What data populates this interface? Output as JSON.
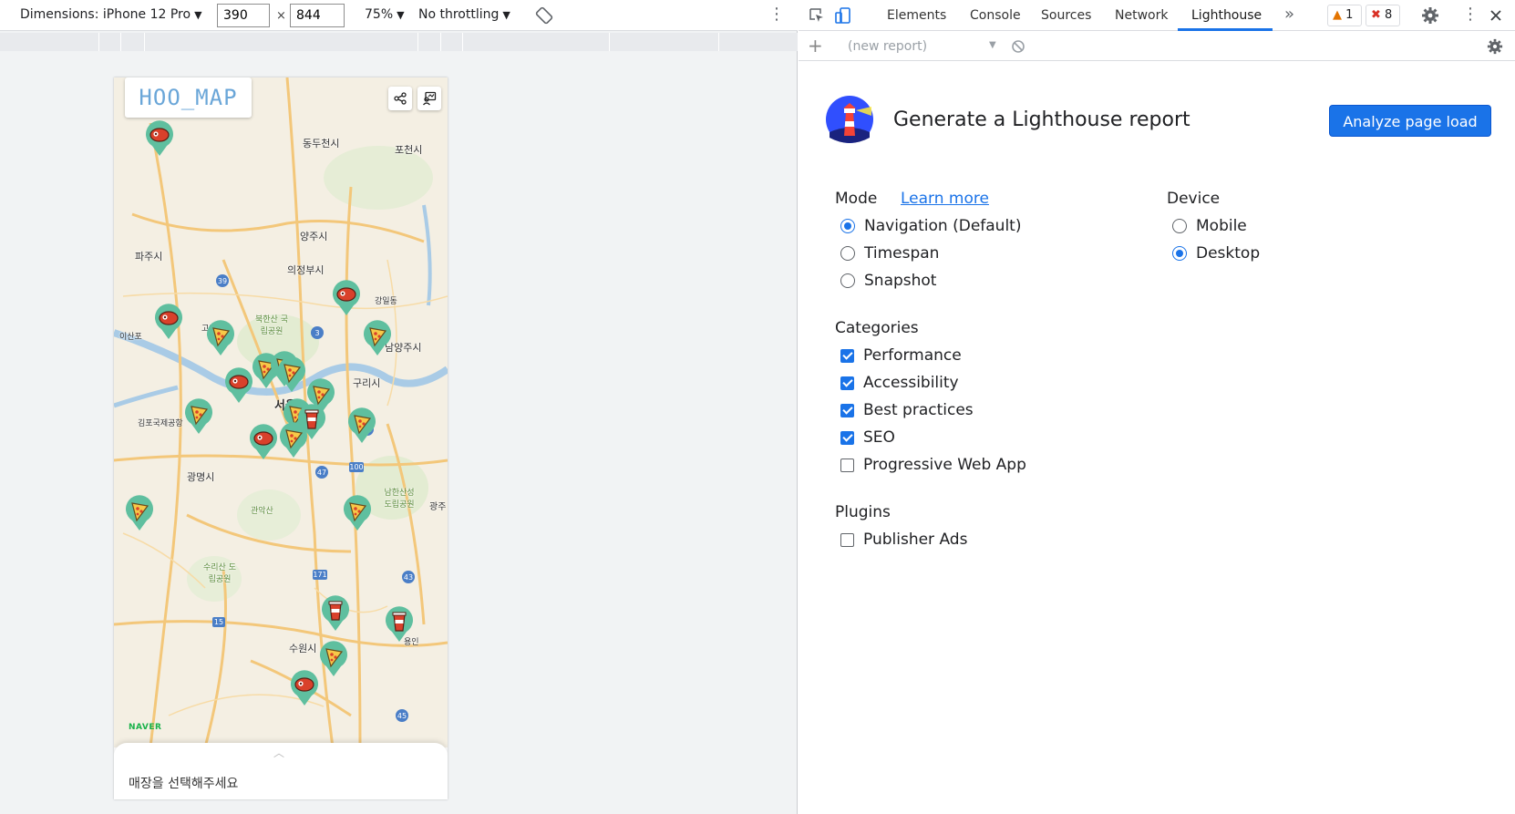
{
  "device_toolbar": {
    "dimensions_label": "Dimensions: iPhone 12 Pro",
    "width_value": "390",
    "times": "×",
    "height_value": "844",
    "zoom": "75%",
    "throttling": "No throttling",
    "caret": "▼",
    "more": "⋮"
  },
  "app": {
    "logo_text": "HOO_MAP",
    "sheet_message": "매장을 선택해주세요",
    "naver_label": "NAVER",
    "handle": "︿",
    "places": [
      "동두천시",
      "포천시",
      "양주시",
      "파주시",
      "의정부시",
      "남양주시",
      "구리시",
      "서울",
      "광명시",
      "수원시",
      "북한산 국립공원",
      "관악산",
      "남한산성 도립공원",
      "수리산 도립공원",
      "이산포",
      "김포국제공항",
      "고양",
      "강일동",
      "광주",
      "용인"
    ]
  },
  "devtools": {
    "tabs": [
      "Elements",
      "Console",
      "Sources",
      "Network",
      "Lighthouse"
    ],
    "active_tab": "Lighthouse",
    "more_tabs": "»",
    "warning_count": "1",
    "error_count": "8",
    "report_placeholder": "(new report)",
    "add_button": "+"
  },
  "lighthouse": {
    "title": "Generate a Lighthouse report",
    "analyze_button": "Analyze page load",
    "mode_label": "Mode",
    "learn_more": "Learn more",
    "modes": [
      "Navigation (Default)",
      "Timespan",
      "Snapshot"
    ],
    "selected_mode": "Navigation (Default)",
    "device_label": "Device",
    "devices": [
      "Mobile",
      "Desktop"
    ],
    "selected_device": "Desktop",
    "categories_label": "Categories",
    "categories": [
      "Performance",
      "Accessibility",
      "Best practices",
      "SEO",
      "Progressive Web App"
    ],
    "categories_checked": [
      true,
      true,
      true,
      true,
      false
    ],
    "plugins_label": "Plugins",
    "plugins": [
      "Publisher Ads"
    ],
    "plugins_checked": [
      false
    ]
  },
  "colors": {
    "accent": "#1a73e8",
    "pin_green": "#5fbf9f",
    "map_road": "#f3c77a",
    "river": "#a9cbe6",
    "logo": "#6aa6d8"
  }
}
